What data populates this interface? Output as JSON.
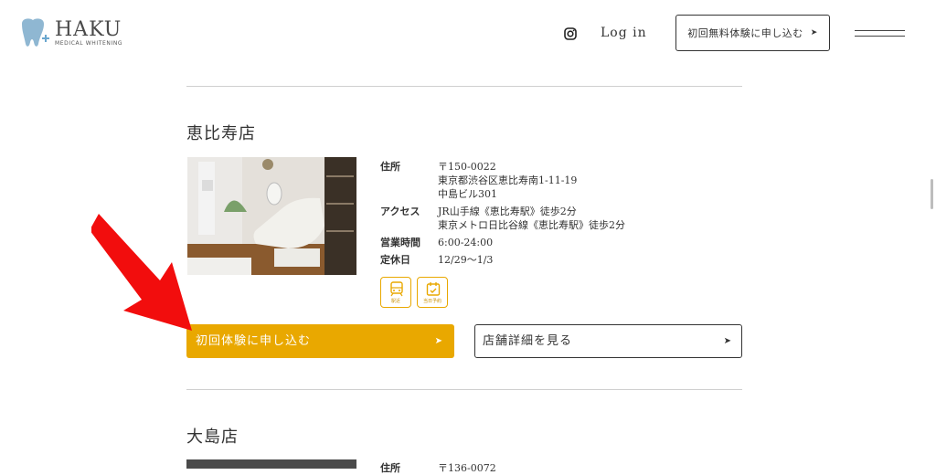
{
  "header": {
    "logo_text": "HAKU",
    "logo_sub": "MEDICAL WHITENING",
    "login_label": "Log in",
    "trial_button_label": "初回無料体験に申し込む",
    "arrow_glyph": "➤"
  },
  "stores": [
    {
      "name": "恵比寿店",
      "rows": [
        {
          "label": "住所",
          "lines": [
            "〒150-0022",
            "東京都渋谷区恵比寿南1-11-19",
            "中島ビル301"
          ]
        },
        {
          "label": "アクセス",
          "lines": [
            "JR山手線《恵比寿駅》徒歩2分",
            "東京メトロ日比谷線《恵比寿駅》徒歩2分"
          ]
        },
        {
          "label": "営業時間",
          "lines": [
            "6:00-24:00"
          ]
        },
        {
          "label": "定休日",
          "lines": [
            "12/29〜1/3"
          ]
        }
      ],
      "badges": [
        {
          "icon": "train-icon",
          "label": "駅近"
        },
        {
          "icon": "calendar-check-icon",
          "label": "当日予約"
        }
      ],
      "apply_label": "初回体験に申し込む",
      "detail_label": "店舗詳細を見る"
    },
    {
      "name": "大島店",
      "rows": [
        {
          "label": "住所",
          "lines": [
            "〒136-0072"
          ]
        }
      ]
    }
  ],
  "colors": {
    "accent": "#e9a800",
    "annotation_arrow": "#f20d0d",
    "logo_tooth": "#8fb7d2"
  }
}
